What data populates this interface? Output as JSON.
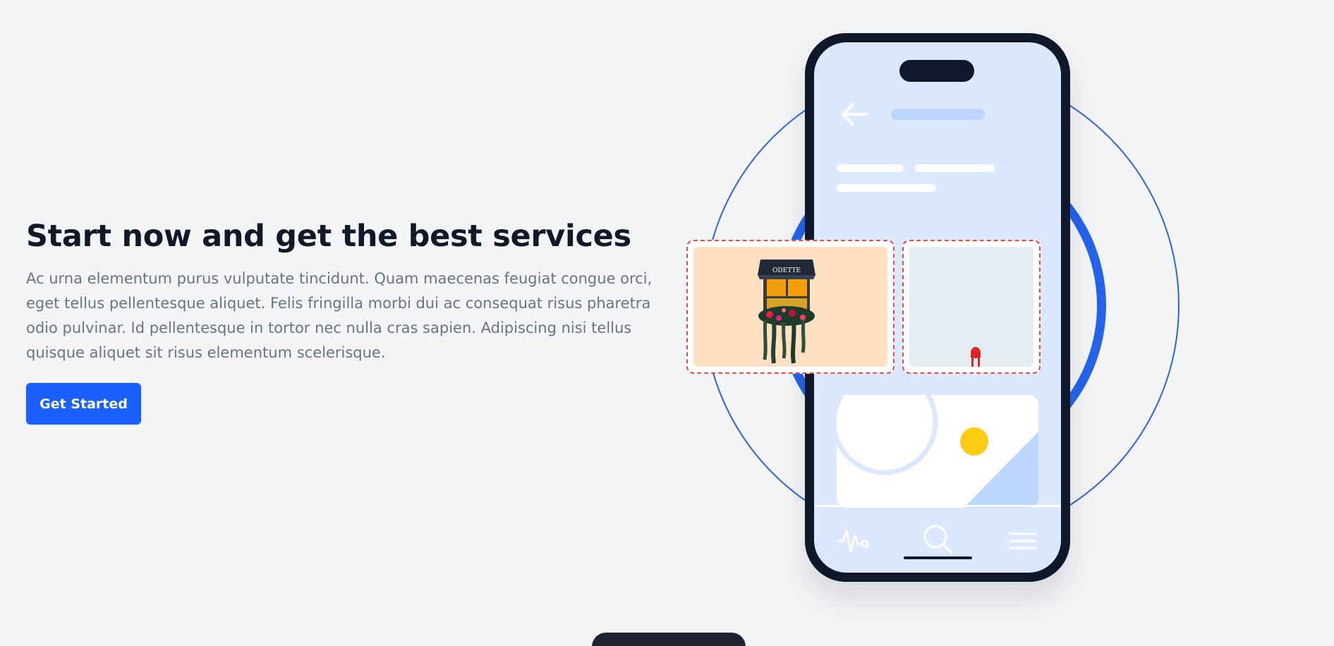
{
  "hero": {
    "title": "Start now and get the best services",
    "description": "Ac urna elementum purus vulputate tincidunt. Quam maecenas feugiat congue orci, eget tellus pellentesque aliquet. Felis fringilla morbi dui ac consequat risus pharetra odio pulvinar. Id pellentesque in tortor nec nulla cras sapien. Adipiscing nisi tellus quisque aliquet sit risus elementum scelerisque.",
    "cta_label": "Get Started"
  },
  "photos": [
    {
      "sign_text": "ODETTE"
    },
    {}
  ],
  "colors": {
    "page_background": "#f3f4f6",
    "primary": "#1a5fff",
    "ring": "#2563eb",
    "phone_body": "#0f172a",
    "phone_screen": "#dbe8fd",
    "accent_yellow": "#facc15",
    "dashed_border": "#e34b4b"
  },
  "icons": [
    "back-arrow-icon",
    "activity-icon",
    "search-icon",
    "menu-icon",
    "image-placeholder-icon"
  ]
}
